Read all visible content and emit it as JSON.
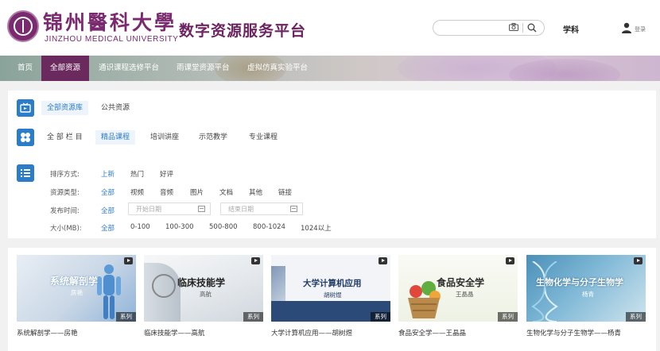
{
  "header": {
    "logo_cn": "锦州醫科大學",
    "logo_en": "JINZHOU MEDICAL UNIVERSITY",
    "site_title": "数字资源服务平台",
    "search_placeholder": "",
    "subject_link": "学科",
    "user_label": "登录"
  },
  "nav": {
    "items": [
      {
        "label": "首页"
      },
      {
        "label": "全部资源"
      },
      {
        "label": "通识课程选修平台"
      },
      {
        "label": "雨课堂资源平台"
      },
      {
        "label": "虚拟仿真实验平台"
      }
    ]
  },
  "library_row": {
    "tabs": [
      {
        "label": "全部资源库"
      },
      {
        "label": "公共资源"
      }
    ]
  },
  "column_row": {
    "tabs": [
      {
        "label": "全 部 栏 目"
      },
      {
        "label": "精品课程"
      },
      {
        "label": "培训讲座"
      },
      {
        "label": "示范教学"
      },
      {
        "label": "专业课程"
      }
    ]
  },
  "filters": {
    "sort": {
      "label": "排序方式:",
      "options": [
        "上新",
        "热门",
        "好评"
      ]
    },
    "type": {
      "label": "资源类型:",
      "options": [
        "全部",
        "视频",
        "音频",
        "图片",
        "文档",
        "其他",
        "链接"
      ]
    },
    "date": {
      "label": "发布时间:",
      "all": "全部",
      "start_placeholder": "开始日期",
      "end_placeholder": "结束日期"
    },
    "size": {
      "label": "大小(MB):",
      "options": [
        "全部",
        "0-100",
        "100-300",
        "500-800",
        "800-1024",
        "1024以上"
      ]
    }
  },
  "cards": [
    {
      "title": "系统解剖学",
      "author": "房艳",
      "badge": "系列",
      "caption": "系统解剖学——房艳"
    },
    {
      "title": "临床技能学",
      "author": "高航",
      "badge": "系列",
      "caption": "临床技能学——高航"
    },
    {
      "title": "大学计算机应用",
      "author": "胡树煜",
      "badge": "系列",
      "caption": "大学计算机应用——胡树煜"
    },
    {
      "title": "食品安全学",
      "author": "王晶晶",
      "badge": "系列",
      "caption": "食品安全学——王晶晶"
    },
    {
      "title": "生物化学与分子生物学",
      "author": "杨青",
      "badge": "系列",
      "caption": "生物化学与分子生物学——杨青"
    }
  ],
  "colors": {
    "brand": "#7a2a6e",
    "nav_active": "#6b2a5e",
    "accent_blue": "#2b7cc9"
  },
  "icons": [
    "search-icon",
    "camera-icon",
    "user-icon",
    "library-icon",
    "grid-icon",
    "list-icon",
    "calendar-icon",
    "play-icon"
  ]
}
